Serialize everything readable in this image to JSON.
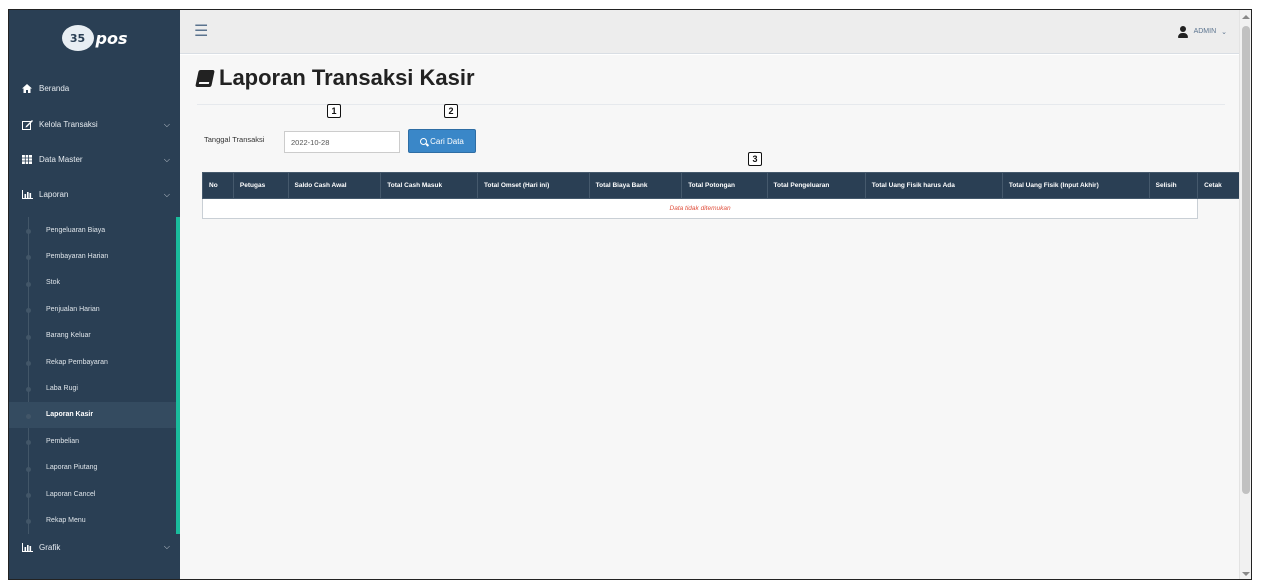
{
  "brand": {
    "logo_text": "pos",
    "logo_mark": "35"
  },
  "sidebar": {
    "items": [
      {
        "label": "Beranda",
        "icon": "home-icon",
        "has_chevron": false
      },
      {
        "label": "Kelola Transaksi",
        "icon": "edit-icon",
        "has_chevron": true
      },
      {
        "label": "Data Master",
        "icon": "table-icon",
        "has_chevron": true
      },
      {
        "label": "Laporan",
        "icon": "chart-icon",
        "has_chevron": true,
        "expanded": true
      },
      {
        "label": "Grafik",
        "icon": "chart-icon",
        "has_chevron": true
      }
    ],
    "laporan_submenu": [
      "Pengeluaran Biaya",
      "Pembayaran Harian",
      "Stok",
      "Penjualan Harian",
      "Barang Keluar",
      "Rekap Pembayaran",
      "Laba Rugi",
      "Laporan Kasir",
      "Pembelian",
      "Laporan Piutang",
      "Laporan Cancel",
      "Rekap Menu"
    ],
    "active_submenu": "Laporan Kasir",
    "accent_color": "#1abb9c"
  },
  "topnav": {
    "user_label": "ADMIN",
    "user_chevron": "⌄"
  },
  "page": {
    "title": "Laporan Transaksi Kasir",
    "filter_label": "Tanggal Transaksi",
    "date_value": "2022-10-28",
    "search_button": "Cari Data"
  },
  "markers": [
    "1",
    "2",
    "3"
  ],
  "table": {
    "columns": [
      "No",
      "Petugas",
      "Saldo Cash Awal",
      "Total Cash Masuk",
      "Total Omset (Hari ini)",
      "Total Biaya Bank",
      "Total Potongan",
      "Total Pengeluaran",
      "Total Uang Fisik harus Ada",
      "Total Uang Fisik (Input Akhir)",
      "Selisih",
      "Cetak"
    ],
    "empty_message": "Data tidak ditemukan"
  },
  "colors": {
    "sidebar": "#2a3f54",
    "primary_button": "#3a87c8",
    "empty_text": "#e0503e"
  }
}
